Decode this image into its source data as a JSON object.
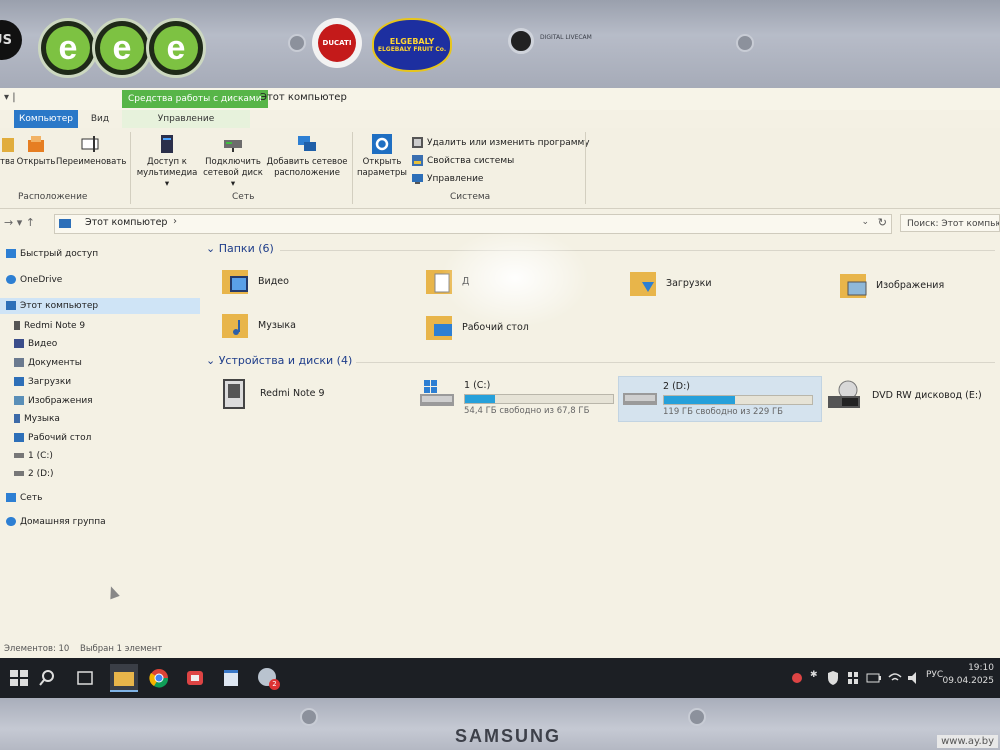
{
  "bezel": {
    "webcam_label": "DIGITAL LIVECAM",
    "brand": "SAMSUNG",
    "stickers": {
      "asus": "US",
      "e_letter": "e",
      "ducati": "DUCATI",
      "elgebaly_top": "ELGEBALY",
      "elgebaly_bottom": "ELGEBALY FRUIT Co."
    },
    "watermark": "www.ay.by"
  },
  "window": {
    "qat": "▾ |",
    "context_group": "Средства работы с дисками",
    "title": "Этот компьютер",
    "tabs": [
      "Компьютер",
      "Вид",
      "Управление"
    ]
  },
  "ribbon": {
    "location": {
      "items": [
        "тва",
        "Открыть",
        "Переименовать"
      ],
      "label": "Расположение"
    },
    "network": {
      "media_access": [
        "Доступ к",
        "мультимедиа ▾"
      ],
      "map_drive": [
        "Подключить",
        "сетевой диск ▾"
      ],
      "add_location": [
        "Добавить сетевое",
        "расположение"
      ],
      "label": "Сеть"
    },
    "system": {
      "open_settings": [
        "Открыть",
        "параметры"
      ],
      "uninstall": "Удалить или изменить программу",
      "properties": "Свойства системы",
      "manage": "Управление",
      "label": "Система"
    }
  },
  "address": {
    "nav": "→  ▾  ↑",
    "path": "Этот компьютер",
    "chevron": "›",
    "dropdown": "⌄",
    "refresh": "↻",
    "search_placeholder": "Поиск: Этот компьютер"
  },
  "nav_pane": [
    {
      "label": "Быстрый доступ",
      "icon": "star-icon",
      "color": "#2d7fd3"
    },
    {
      "label": "OneDrive",
      "icon": "cloud-icon",
      "color": "#2d7fd3"
    },
    {
      "label": "Этот компьютер",
      "icon": "computer-icon",
      "color": "#2d6fb8",
      "selected": true
    },
    {
      "label": "Redmi Note 9",
      "icon": "phone-icon",
      "color": "#555555"
    },
    {
      "label": "Видео",
      "icon": "video-folder-icon",
      "color": "#3b4d8a"
    },
    {
      "label": "Документы",
      "icon": "documents-icon",
      "color": "#6b7a8f"
    },
    {
      "label": "Загрузки",
      "icon": "downloads-icon",
      "color": "#2d6fb8"
    },
    {
      "label": "Изображения",
      "icon": "pictures-icon",
      "color": "#5a8fb8"
    },
    {
      "label": "Музыка",
      "icon": "music-icon",
      "color": "#3c6aa8"
    },
    {
      "label": "Рабочий стол",
      "icon": "desktop-icon",
      "color": "#2d6fb8"
    },
    {
      "label": "1 (C:)",
      "icon": "drive-icon",
      "color": "#777777"
    },
    {
      "label": "2 (D:)",
      "icon": "drive-icon",
      "color": "#777777"
    },
    {
      "label": "Сеть",
      "icon": "network-icon",
      "color": "#2d7fd3"
    },
    {
      "label": "Домашняя группа",
      "icon": "homegroup-icon",
      "color": "#2d7fd3"
    }
  ],
  "folders_section": {
    "title": "Папки (6)",
    "items": [
      {
        "label": "Видео",
        "icon": "video-folder-icon"
      },
      {
        "label": "Д",
        "icon": "documents-folder-icon"
      },
      {
        "label": "Загрузки",
        "icon": "downloads-folder-icon"
      },
      {
        "label": "Изображения",
        "icon": "pictures-folder-icon"
      },
      {
        "label": "Музыка",
        "icon": "music-folder-icon"
      },
      {
        "label": "Рабочий стол",
        "icon": "desktop-folder-icon"
      }
    ]
  },
  "devices_section": {
    "title": "Устройства и диски (4)",
    "items": [
      {
        "name": "Redmi Note 9",
        "type": "phone"
      },
      {
        "name": "1 (C:)",
        "free_text": "54,4 ГБ свободно из 67,8 ГБ",
        "used_fraction": 0.2
      },
      {
        "name": "2 (D:)",
        "free_text": "119 ГБ свободно из 229 ГБ",
        "used_fraction": 0.48
      },
      {
        "name": "DVD RW дисковод (E:)",
        "type": "dvd"
      }
    ]
  },
  "status": {
    "items_count": "Элементов: 10",
    "selected": "Выбран 1 элемент"
  },
  "taskbar": {
    "lang": "РУС",
    "time": "19:10",
    "date": "09.04.2025",
    "badge": "2"
  },
  "colors": {
    "accent": "#2a78c8",
    "drive_bar": "#26a0da",
    "context_tab": "#57b548",
    "selection": "#cfe4f6",
    "section_header": "#1e3d8a"
  }
}
